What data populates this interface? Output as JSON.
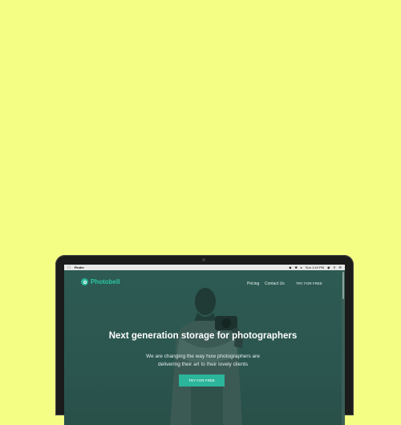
{
  "menubar": {
    "apple_icon": "",
    "app_name": "Finder",
    "clock": "Sun 1:44 PM"
  },
  "site": {
    "logo_text": "Photobell",
    "nav": {
      "pricing": "Pricing",
      "contact": "Contact Us",
      "cta": "TRY FOR FREE"
    },
    "hero": {
      "headline": "Next generation storage for photographers",
      "subtext": "We are changing the way how photographers are delivering their art to their lovely clients",
      "cta": "TRY FOR FREE"
    }
  },
  "colors": {
    "background": "#f4fe85",
    "accent": "#2bb59a",
    "hero_overlay": "#2f5a52"
  }
}
